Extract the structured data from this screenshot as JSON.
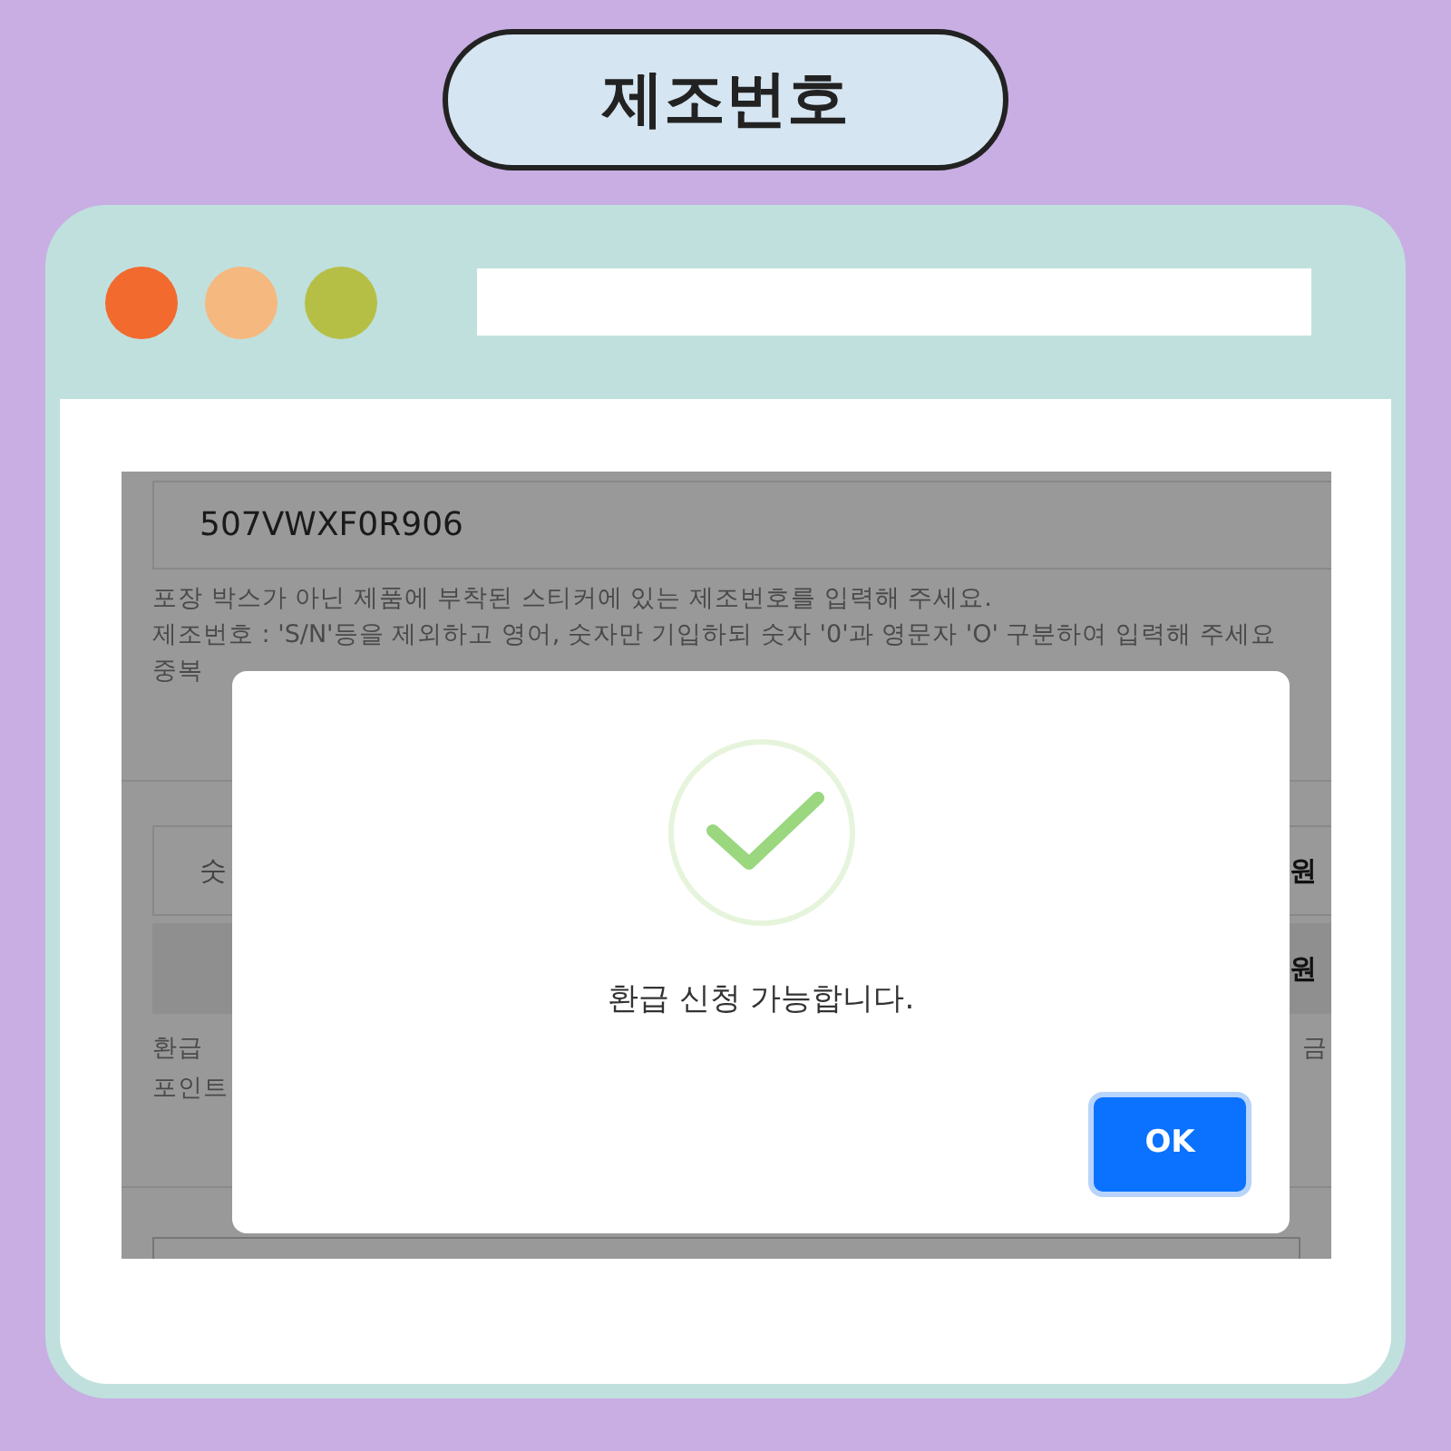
{
  "title_badge": "제조번호",
  "browser": {
    "dots": [
      {
        "color": "#f26a2e"
      },
      {
        "color": "#f5b87e"
      },
      {
        "color": "#b5bf45"
      }
    ]
  },
  "page": {
    "serial_field": {
      "value": "507VWXF0R906"
    },
    "notes": [
      "포장 박스가 아닌 제품에 부착된 스티커에 있는 제조번호를 입력해 주세요.",
      "제조번호 : 'S/N'등을 제외하고 영어, 숫자만 기입하되 숫자 '0'과 영문자 'O' 구분하여 입력해 주세요",
      "중복"
    ],
    "row_1": {
      "label": "숫",
      "unit": "원"
    },
    "row_2": {
      "unit": "원"
    },
    "notes_2": [
      {
        "left": "환급",
        "right": "금"
      },
      {
        "left": "포인트"
      }
    ]
  },
  "dialog": {
    "message": "환급 신청 가능합니다.",
    "button": "OK"
  }
}
